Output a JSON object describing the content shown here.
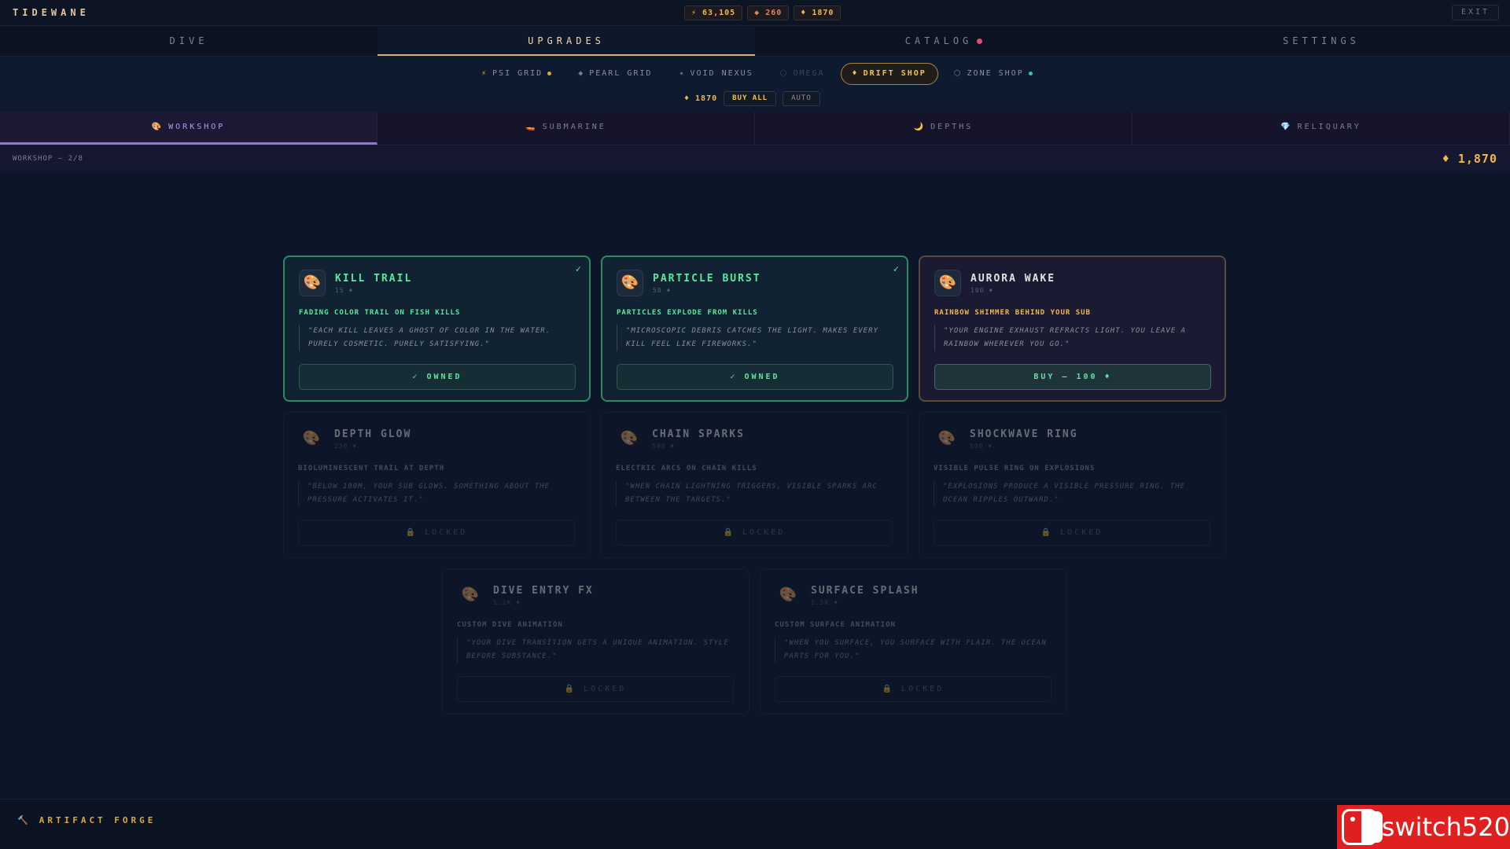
{
  "app": {
    "brand": "TIDEWANE",
    "exit": "EXIT"
  },
  "currencies": {
    "energy": "⚡ 63,105",
    "pearls": "◆ 260",
    "gold": "♦ 1870"
  },
  "main_nav": [
    {
      "label": "DIVE"
    },
    {
      "label": "UPGRADES"
    },
    {
      "label": "CATALOG"
    },
    {
      "label": "SETTINGS"
    }
  ],
  "shops": [
    {
      "icon": "⚡",
      "label": "PSI GRID"
    },
    {
      "icon": "◆",
      "label": "PEARL GRID"
    },
    {
      "icon": "✦",
      "label": "VOID NEXUS"
    },
    {
      "icon": "⬡",
      "label": "OMEGA"
    },
    {
      "icon": "♦",
      "label": "DRIFT SHOP"
    },
    {
      "icon": "⬡",
      "label": "ZONE SHOP"
    }
  ],
  "shop_actions": {
    "amount": "♦ 1870",
    "buy_all": "BUY ALL",
    "auto": "AUTO"
  },
  "category_tabs": [
    {
      "icon": "🎨",
      "label": "WORKSHOP"
    },
    {
      "icon": "🚤",
      "label": "SUBMARINE"
    },
    {
      "icon": "🌙",
      "label": "DEPTHS"
    },
    {
      "icon": "💎",
      "label": "RELIQUARY"
    }
  ],
  "status": {
    "left": "WORKSHOP — 2/8",
    "right": "♦ 1,870"
  },
  "cards": [
    {
      "name": "KILL TRAIL",
      "cost": "15 ♦",
      "tag": "FADING COLOR TRAIL ON FISH KILLS",
      "quote": "\"EACH KILL LEAVES A GHOST OF COLOR IN THE WATER. PURELY COSMETIC. PURELY SATISFYING.\"",
      "cta": "✓ OWNED",
      "check": "✓",
      "state": "owned"
    },
    {
      "name": "PARTICLE BURST",
      "cost": "50 ♦",
      "tag": "PARTICLES EXPLODE FROM KILLS",
      "quote": "\"MICROSCOPIC DEBRIS CATCHES THE LIGHT. MAKES EVERY KILL FEEL LIKE FIREWORKS.\"",
      "cta": "✓ OWNED",
      "check": "✓",
      "state": "owned"
    },
    {
      "name": "AURORA WAKE",
      "cost": "100 ♦",
      "tag": "RAINBOW SHIMMER BEHIND YOUR SUB",
      "quote": "\"YOUR ENGINE EXHAUST REFRACTS LIGHT. YOU LEAVE A RAINBOW WHEREVER YOU GO.\"",
      "cta": "BUY — 100 ♦",
      "check": "",
      "state": "buy"
    },
    {
      "name": "DEPTH GLOW",
      "cost": "250 ♦",
      "tag": "BIOLUMINESCENT TRAIL AT DEPTH",
      "quote": "\"BELOW 100M, YOUR SUB GLOWS. SOMETHING ABOUT THE PRESSURE ACTIVATES IT.\"",
      "cta": "🔒 LOCKED",
      "check": "",
      "state": "locked"
    },
    {
      "name": "CHAIN SPARKS",
      "cost": "500 ♦",
      "tag": "ELECTRIC ARCS ON CHAIN KILLS",
      "quote": "\"WHEN CHAIN LIGHTNING TRIGGERS, VISIBLE SPARKS ARC BETWEEN THE TARGETS.\"",
      "cta": "🔒 LOCKED",
      "check": "",
      "state": "locked"
    },
    {
      "name": "SHOCKWAVE RING",
      "cost": "500 ♦",
      "tag": "VISIBLE PULSE RING ON EXPLOSIONS",
      "quote": "\"EXPLOSIONS PRODUCE A VISIBLE PRESSURE RING. THE OCEAN RIPPLES OUTWARD.\"",
      "cta": "🔒 LOCKED",
      "check": "",
      "state": "locked"
    },
    {
      "name": "DIVE ENTRY FX",
      "cost": "1.2K ♦",
      "tag": "CUSTOM DIVE ANIMATION",
      "quote": "\"YOUR DIVE TRANSITION GETS A UNIQUE ANIMATION. STYLE BEFORE SUBSTANCE.\"",
      "cta": "🔒 LOCKED",
      "check": "",
      "state": "locked"
    },
    {
      "name": "SURFACE SPLASH",
      "cost": "1.5K ♦",
      "tag": "CUSTOM SURFACE ANIMATION",
      "quote": "\"WHEN YOU SURFACE, YOU SURFACE WITH FLAIR. THE OCEAN PARTS FOR YOU.\"",
      "cta": "🔒 LOCKED",
      "check": "",
      "state": "locked"
    }
  ],
  "card_icon": "🎨",
  "footer": {
    "icon": "🔨",
    "label": "ARTIFACT FORGE"
  },
  "watermark": {
    "text": "switch520"
  }
}
